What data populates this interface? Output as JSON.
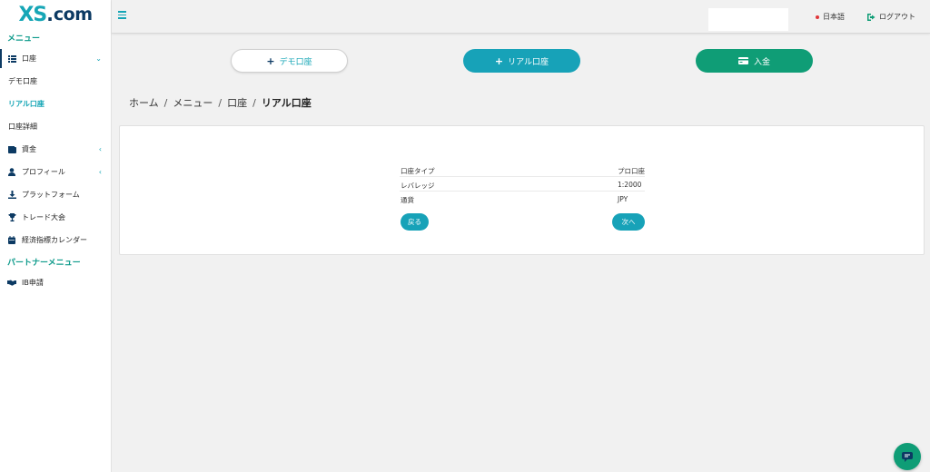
{
  "brand": {
    "logo_xs": "XS",
    "logo_dot": ".",
    "logo_com": "com"
  },
  "sidebar": {
    "menu_title": "メニュー",
    "items": [
      {
        "label": "口座",
        "icon": "list-icon"
      },
      {
        "label": "デモ口座"
      },
      {
        "label": "リアル口座"
      },
      {
        "label": "口座詳細"
      },
      {
        "label": "資金",
        "icon": "wallet-icon"
      },
      {
        "label": "プロフィール",
        "icon": "user-icon"
      },
      {
        "label": "プラットフォーム",
        "icon": "download-icon"
      },
      {
        "label": "トレード大会",
        "icon": "trophy-icon"
      },
      {
        "label": "経済指標カレンダー",
        "icon": "calendar-icon"
      }
    ],
    "partner_title": "パートナーメニュー",
    "partner_items": [
      {
        "label": "IB申請",
        "icon": "handshake-icon"
      }
    ]
  },
  "header": {
    "language": "日本語",
    "logout": "ログアウト"
  },
  "actions": {
    "demo": "デモ口座",
    "real": "リアル口座",
    "deposit": "入金"
  },
  "breadcrumb": [
    "ホーム",
    "メニュー",
    "口座",
    "リアル口座"
  ],
  "account": {
    "rows": [
      {
        "key": "口座タイプ",
        "value": "プロ口座"
      },
      {
        "key": "レバレッジ",
        "value": "1:2000"
      },
      {
        "key": "通貨",
        "value": "JPY"
      }
    ],
    "back": "戻る",
    "next": "次へ"
  },
  "colors": {
    "teal": "#17a2b8",
    "green": "#0f9d76",
    "navy": "#0c3a63"
  }
}
